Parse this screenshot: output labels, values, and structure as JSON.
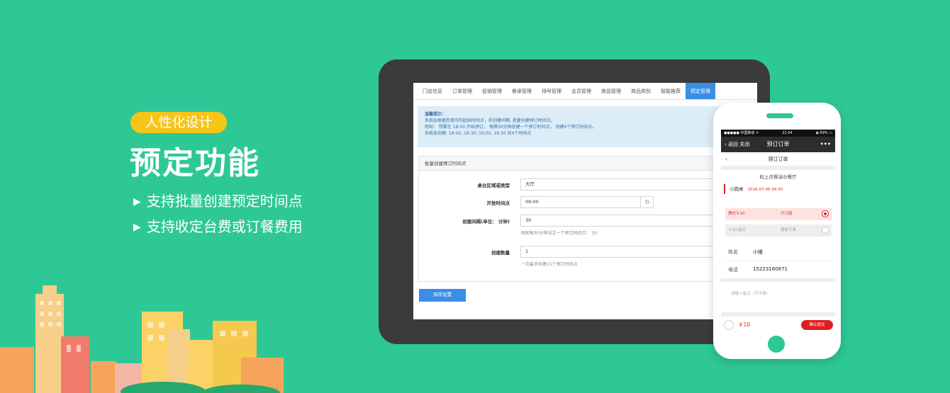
{
  "hero": {
    "badge": "人性化设计",
    "title": "预定功能",
    "features": [
      "支持批量创建预定时间点",
      "支持收定台费或订餐费用"
    ]
  },
  "admin": {
    "nav": [
      "门店信息",
      "订单管理",
      "促销管理",
      "餐桌管理",
      "排号管理",
      "会员管理",
      "商品管理",
      "商品类别",
      "智能推荐",
      "预定管理"
    ],
    "active_nav": "预定管理",
    "tip": {
      "title": "温馨提示：",
      "lines": [
        "系统会根据您填写的起始时间点，和创建间隔, 批量创建预订时间点。",
        "例如： 想要在 18:00 开始预订， 每隔30分钟创建一个预订时间点， 创建4个预订时间点。",
        "系统会创建: 18:00, 18:30, 19:00, 19:30 共4个时间点"
      ]
    },
    "panel_title": "批量创建预订时间点",
    "form": {
      "area_label": "桌台区域或类型",
      "area_value": "大厅",
      "start_label": "开放时间点",
      "start_value": "09:00",
      "interval_label": "创建间隔(单位： 分钟)",
      "interval_value": "30",
      "interval_hint": "例如每30分钟设立一个预订时间点： 30",
      "count_label": "创建数量",
      "count_value": "1",
      "count_hint": "一次最多创建15个预订时间点"
    },
    "save_label": "保存设置"
  },
  "phone": {
    "status_left": "●●●●● 中国移动 ᯤ",
    "status_time": "21:54",
    "status_right": "◉ 69% ▭",
    "back_label": "‹ 返回  关闭",
    "nav_title": "预订订单",
    "more": "•••",
    "sub_title": "预订订单",
    "sub_back": "‹",
    "restaurant": "码上点餐演示餐厅",
    "table_name": "小圆桌",
    "table_time": "2016-07-06 09:30",
    "opt1_a": "预付￥10",
    "opt1_b": "只订座",
    "opt2_a": "￥10 起订",
    "opt2_b": "提前下单",
    "name_label": "姓名",
    "name_value": "小维",
    "phone_label": "电话",
    "phone_value": "15223160871",
    "remark_placeholder": "请输入备注（可不填）",
    "price": "￥10",
    "confirm_label": "确认提交"
  },
  "colors": {
    "background": "#2ec896",
    "accent": "#3a8ee6",
    "badge": "#f5c518",
    "red": "#e02020"
  }
}
